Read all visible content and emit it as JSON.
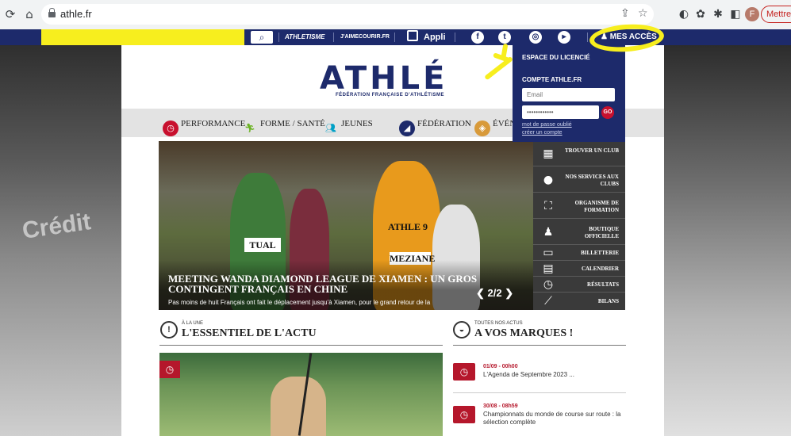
{
  "browser": {
    "url": "athle.fr",
    "update_label": "Mettre"
  },
  "profile_initial": "F",
  "topbar": {
    "search_placeholder": "",
    "link_athletisme": "ATHLETISME",
    "link_jaimecourir": "J'AIMECOURIR.FR",
    "appli_label": "Appli",
    "mes_acces_label": "MES ACCÈS"
  },
  "logo": {
    "wordmark": "ATHLÉ",
    "tagline": "FÉDÉRATION FRANÇAISE D'ATHLÉTISME"
  },
  "menu": [
    {
      "label": "PERFORMANCE",
      "icon": "stopwatch-icon",
      "color": "#c8102e"
    },
    {
      "label": "FORME / SANTÉ",
      "icon": "runner-icon",
      "color": "#6bb324"
    },
    {
      "label": "JEUNES",
      "icon": "kids-icon",
      "color": "#00a0c6"
    },
    {
      "label": "FÉDÉRATION",
      "icon": "federation-icon",
      "color": "#1d2a6b"
    },
    {
      "label": "ÉVÉN",
      "icon": "event-icon",
      "color": "#d89a3a"
    }
  ],
  "hero": {
    "title": "MEETING WANDA DIAMOND LEAGUE DE XIAMEN : UN GROS CONTINGENT FRANÇAIS EN CHINE",
    "description": "Pas moins de huit Français ont fait le déplacement jusqu'à Xiamen, pour le grand retour de la",
    "pager": "2/2",
    "bibs": [
      "TUAL",
      "ATHLE 9",
      "MEZIANE"
    ]
  },
  "quick_links": [
    {
      "label": "TROUVER UN CLUB",
      "icon": "map-icon"
    },
    {
      "label": "NOS SERVICES AUX CLUBS",
      "icon": "service-clubs-icon"
    },
    {
      "label": "ORGANISME DE FORMATION",
      "icon": "training-icon"
    },
    {
      "label": "BOUTIQUE OFFICIELLE",
      "icon": "shirt-icon"
    },
    {
      "label": "BILLETTERIE",
      "icon": "ticket-icon"
    },
    {
      "label": "CALENDRIER",
      "icon": "calendar-icon"
    },
    {
      "label": "RÉSULTATS",
      "icon": "stopwatch-icon"
    },
    {
      "label": "BILANS",
      "icon": "chart-icon"
    }
  ],
  "actu": {
    "kicker": "À LA UNE",
    "title": "L'ESSENTIEL DE L'ACTU"
  },
  "marques": {
    "kicker": "TOUTES NOS ACTUS",
    "title": "A VOS MARQUES !",
    "items": [
      {
        "time": "01/09 - 00h00",
        "text": "L'Agenda de Septembre 2023 ..."
      },
      {
        "time": "30/08 - 08h59",
        "text": "Championnats du monde de course sur route : la sélection complète"
      }
    ]
  },
  "dropdown": {
    "espace_label": "ESPACE DU LICENCIÉ",
    "compte_label": "COMPTE ATHLE.FR",
    "email_placeholder": "Email",
    "password_value": "••••••••••••",
    "go_label": "GO",
    "forgot_label": "mot de passe oublié",
    "create_label": "créer un compte"
  },
  "colors": {
    "navy": "#1d2a6b",
    "red": "#c8102e",
    "annotation_yellow": "#f7ee1e"
  }
}
